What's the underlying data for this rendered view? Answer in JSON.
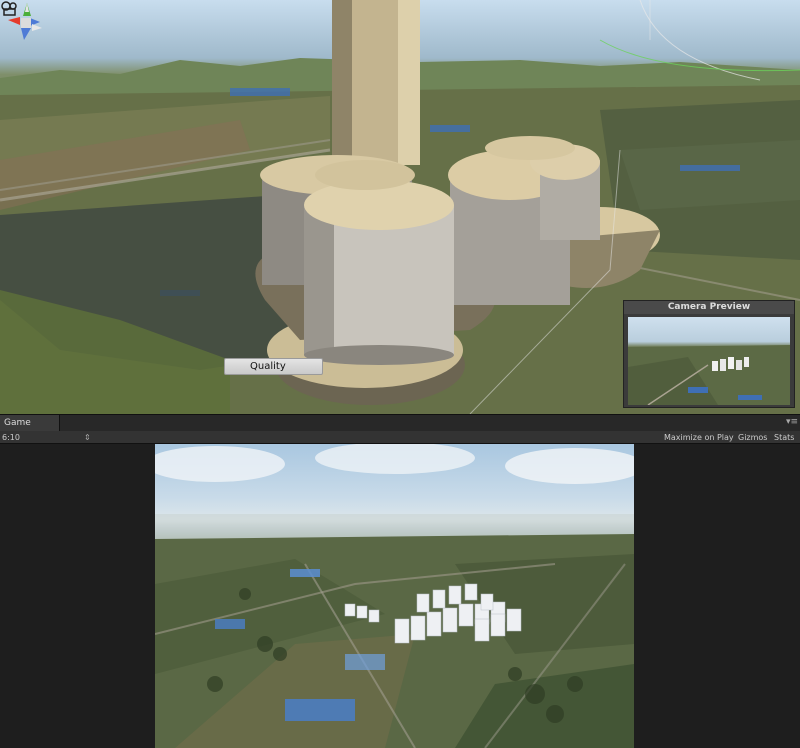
{
  "scene": {
    "quality_button": "Quality",
    "camera_preview_title": "Camera Preview",
    "icons": [
      "camera-icon",
      "orientation-gizmo-icon"
    ]
  },
  "game_panel": {
    "tab_label": "Game",
    "aspect_value": "6:10",
    "maximize_label": "Maximize on Play",
    "gizmos_label": "Gizmos",
    "stats_label": "Stats"
  },
  "colors": {
    "editor_bg": "#1e1e1e",
    "toolbar_bg": "#333333",
    "building_beige": "#d8c9a3",
    "gizmo_red": "#e53b2c",
    "gizmo_green": "#4caf3a",
    "gizmo_blue": "#4f7bd6"
  }
}
